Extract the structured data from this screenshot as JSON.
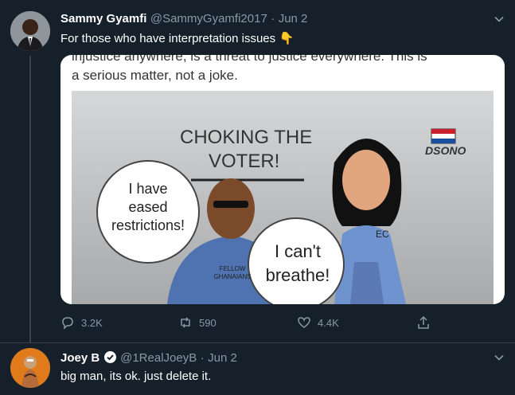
{
  "tweets": [
    {
      "author_name": "Sammy Gyamfi",
      "handle": "@SammyGyamfi2017",
      "separator": "·",
      "date": "Jun 2",
      "text": "For those who have interpretation issues",
      "emoji": "👇",
      "stats": {
        "replies": "3.2K",
        "retweets": "590",
        "likes": "4.4K"
      }
    },
    {
      "author_name": "Joey B",
      "handle": "@1RealJoeyB",
      "separator": "·",
      "date": "Jun 2",
      "text": "big man, its ok. just delete it."
    }
  ],
  "image": {
    "caption_top": "injustice anywhere, is a threat to justice everywhere. This is",
    "caption_line2": "a serious matter, not a joke.",
    "cartoon_title_line1": "CHOKING THE",
    "cartoon_title_line2": "VOTER!",
    "bubble1_line1": "I have",
    "bubble1_line2": "eased",
    "bubble1_line3": "restrictions!",
    "bubble2_line1": "I can't",
    "bubble2_line2": "breathe!",
    "shirt_label": "FELLOW GHANAIANS",
    "ec_label": "EC",
    "signature": "DSONO"
  },
  "colors": {
    "background": "#15202b",
    "muted": "#8899a6",
    "line": "#38444d"
  }
}
